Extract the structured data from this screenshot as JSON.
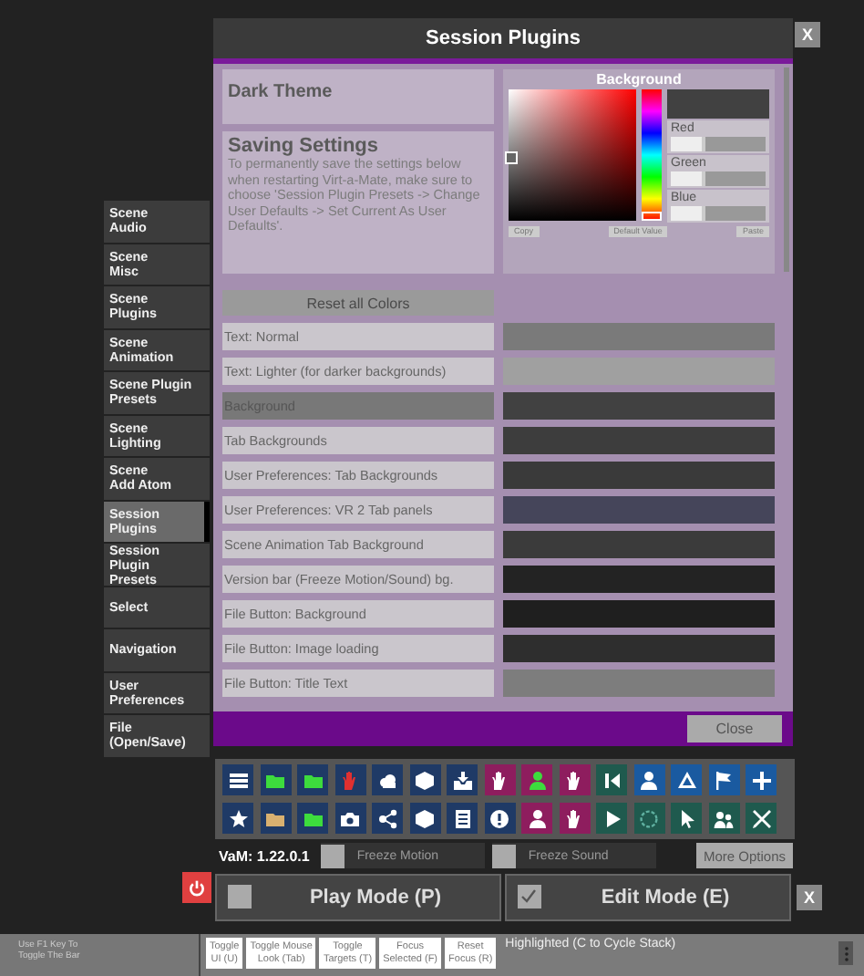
{
  "window": {
    "title": "Session Plugins",
    "close": "X"
  },
  "sidebar": {
    "items": [
      {
        "label": "Scene\nAudio",
        "selected": false
      },
      {
        "label": "Scene\nMisc",
        "selected": false
      },
      {
        "label": "Scene\nPlugins",
        "selected": false
      },
      {
        "label": "Scene\nAnimation",
        "selected": false
      },
      {
        "label": "Scene Plugin\nPresets",
        "selected": false
      },
      {
        "label": "Scene\nLighting",
        "selected": false
      },
      {
        "label": "Scene\nAdd Atom",
        "selected": false
      },
      {
        "label": "Session\nPlugins",
        "selected": true
      },
      {
        "label": "Session Plugin\nPresets",
        "selected": false
      },
      {
        "label": "Select",
        "selected": false
      },
      {
        "label": "Navigation",
        "selected": false
      },
      {
        "label": "User\nPreferences",
        "selected": false
      },
      {
        "label": "File\n(Open/Save)",
        "selected": false
      }
    ]
  },
  "theme_panel": {
    "title": "Dark Theme"
  },
  "saving_settings": {
    "heading": "Saving Settings",
    "text": "To permanently save the settings below when restarting Virt-a-Mate, make sure to choose 'Session Plugin Presets -> Change User Defaults -> Set Current As User Defaults'."
  },
  "color_picker": {
    "title": "Background",
    "sliders": [
      {
        "label": "Red",
        "level": 0.33
      },
      {
        "label": "Green",
        "level": 0.33
      },
      {
        "label": "Blue",
        "level": 0.33
      }
    ],
    "buttons": [
      "Copy",
      "Default Value",
      "Paste"
    ]
  },
  "reset_button": "Reset all Colors",
  "color_rows": [
    {
      "label": "Text: Normal",
      "color": "#7a7a7a",
      "selected": false
    },
    {
      "label": "Text: Lighter (for darker backgrounds)",
      "color": "#a0a0a0",
      "selected": false
    },
    {
      "label": "Background",
      "color": "#414141",
      "selected": true
    },
    {
      "label": "Tab Backgrounds",
      "color": "#3d3d3d",
      "selected": false
    },
    {
      "label": "User Preferences: Tab Backgrounds",
      "color": "#3a3a3a",
      "selected": false
    },
    {
      "label": "User Preferences: VR 2 Tab panels",
      "color": "#45455a",
      "selected": false
    },
    {
      "label": "Scene Animation Tab Background",
      "color": "#3b3b3b",
      "selected": false
    },
    {
      "label": "Version bar (Freeze Motion/Sound) bg.",
      "color": "#232323",
      "selected": false
    },
    {
      "label": "File Button: Background",
      "color": "#1f1f1f",
      "selected": false
    },
    {
      "label": "File Button: Image loading",
      "color": "#2e2e2e",
      "selected": false
    },
    {
      "label": "File Button: Title Text",
      "color": "#7d7d7d",
      "selected": false
    }
  ],
  "close_button": "Close",
  "version": "VaM: 1.22.0.1",
  "toggles": [
    {
      "label": "Freeze Motion",
      "checked": false
    },
    {
      "label": "Freeze Sound",
      "checked": false
    }
  ],
  "more_options": "More Options",
  "modes": [
    {
      "label": "Play Mode (P)",
      "checked": false
    },
    {
      "label": "Edit Mode (E)",
      "checked": true
    }
  ],
  "mode_close": "X",
  "bottom_bar": {
    "hint": "Use F1 Key To\nToggle The Bar",
    "buttons": [
      "Toggle\nUI (U)",
      "Toggle Mouse\nLook (Tab)",
      "Toggle\nTargets (T)",
      "Focus\nSelected (F)",
      "Reset\nFocus (R)"
    ],
    "status": "Highlighted (C to Cycle Stack)"
  }
}
